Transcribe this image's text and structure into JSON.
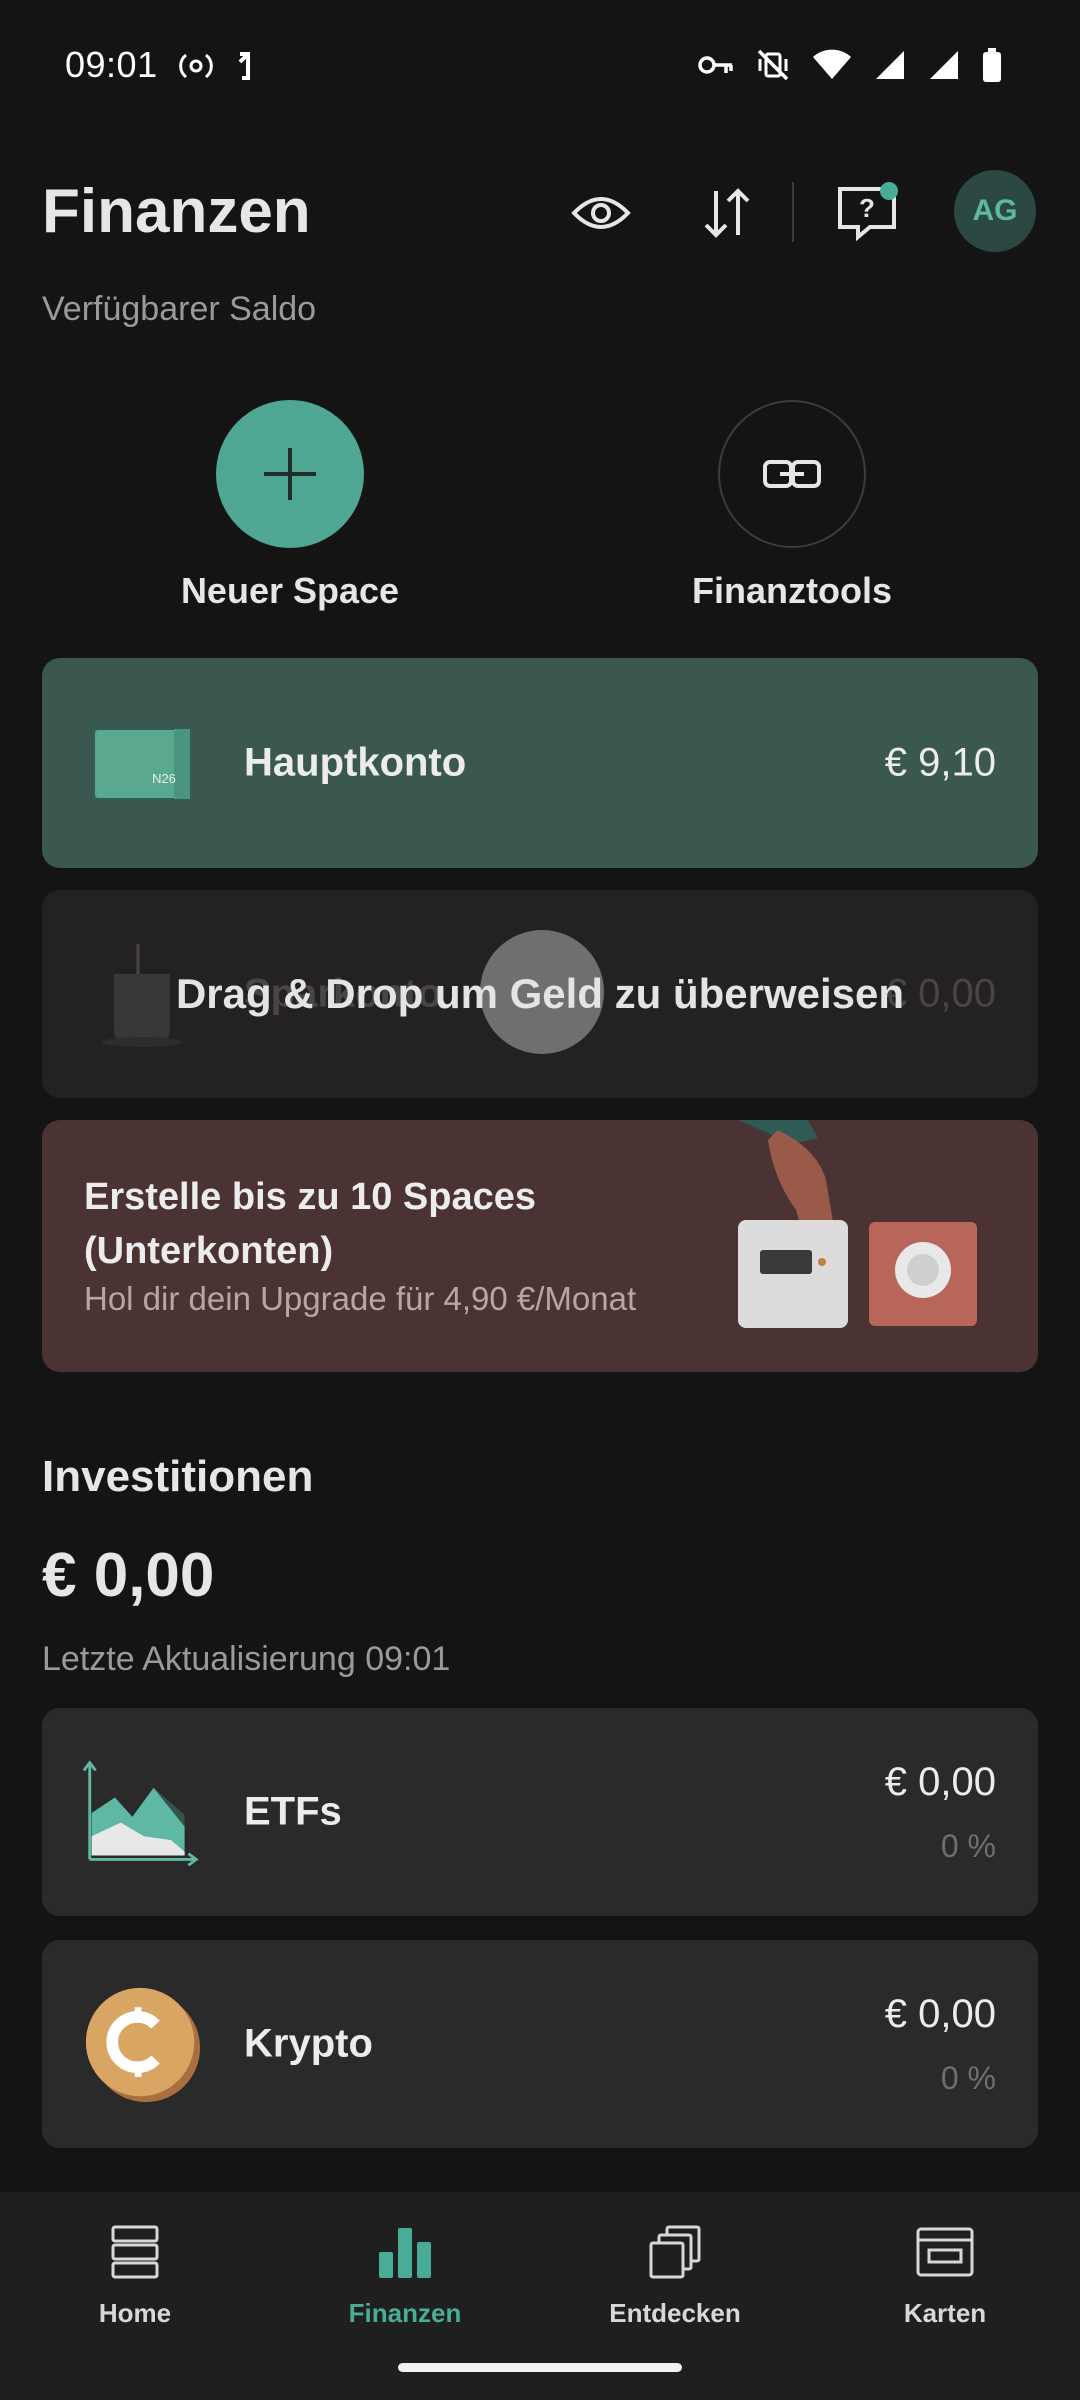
{
  "status_bar": {
    "time": "09:01",
    "left_icons": [
      "hotspot-icon",
      "data-saver-icon"
    ],
    "right_icons": [
      "vpn-key-icon",
      "vibrate-off-icon",
      "wifi-icon",
      "signal-icon",
      "signal-icon",
      "battery-icon"
    ]
  },
  "header": {
    "title": "Finanzen",
    "actions": [
      "eye-icon",
      "transfer-arrows-icon",
      "help-chat-icon"
    ],
    "avatar_initials": "AG",
    "has_notification": true
  },
  "balance": {
    "subtitle": "Verfügbarer Saldo"
  },
  "quick_actions": [
    {
      "label": "Neuer Space",
      "icon": "plus-icon"
    },
    {
      "label": "Finanztools",
      "icon": "link-icon"
    }
  ],
  "accounts": {
    "main": {
      "name": "Hauptkonto",
      "amount": "€ 9,10",
      "icon": "n26-card-icon",
      "card_label": "N26"
    },
    "drag_hint": "Drag & Drop um Geld zu überweisen",
    "second": {
      "name": "Sparkonto",
      "amount": "€ 0,00",
      "icon": "jar-icon"
    }
  },
  "promo": {
    "title": "Erstelle bis zu 10 Spaces (Unterkonten)",
    "subtitle": "Hol dir dein Upgrade für 4,90 €/Monat"
  },
  "investments": {
    "title": "Investitionen",
    "total": "€ 0,00",
    "updated": "Letzte Aktualisierung 09:01",
    "items": [
      {
        "name": "ETFs",
        "amount": "€ 0,00",
        "percent": "0 %",
        "icon": "etf-chart-icon"
      },
      {
        "name": "Krypto",
        "amount": "€ 0,00",
        "percent": "0 %",
        "icon": "crypto-coin-icon"
      }
    ]
  },
  "bottom_nav": {
    "items": [
      {
        "label": "Home",
        "icon": "home-stack-icon",
        "active": false
      },
      {
        "label": "Finanzen",
        "icon": "bar-chart-icon",
        "active": true
      },
      {
        "label": "Entdecken",
        "icon": "discover-cards-icon",
        "active": false
      },
      {
        "label": "Karten",
        "icon": "card-icon",
        "active": false
      }
    ]
  },
  "colors": {
    "accent": "#48ac98",
    "background": "#141414",
    "main_account_card": "#3a5750",
    "promo_card": "#4a3332",
    "investment_card": "#2a2a2a"
  }
}
